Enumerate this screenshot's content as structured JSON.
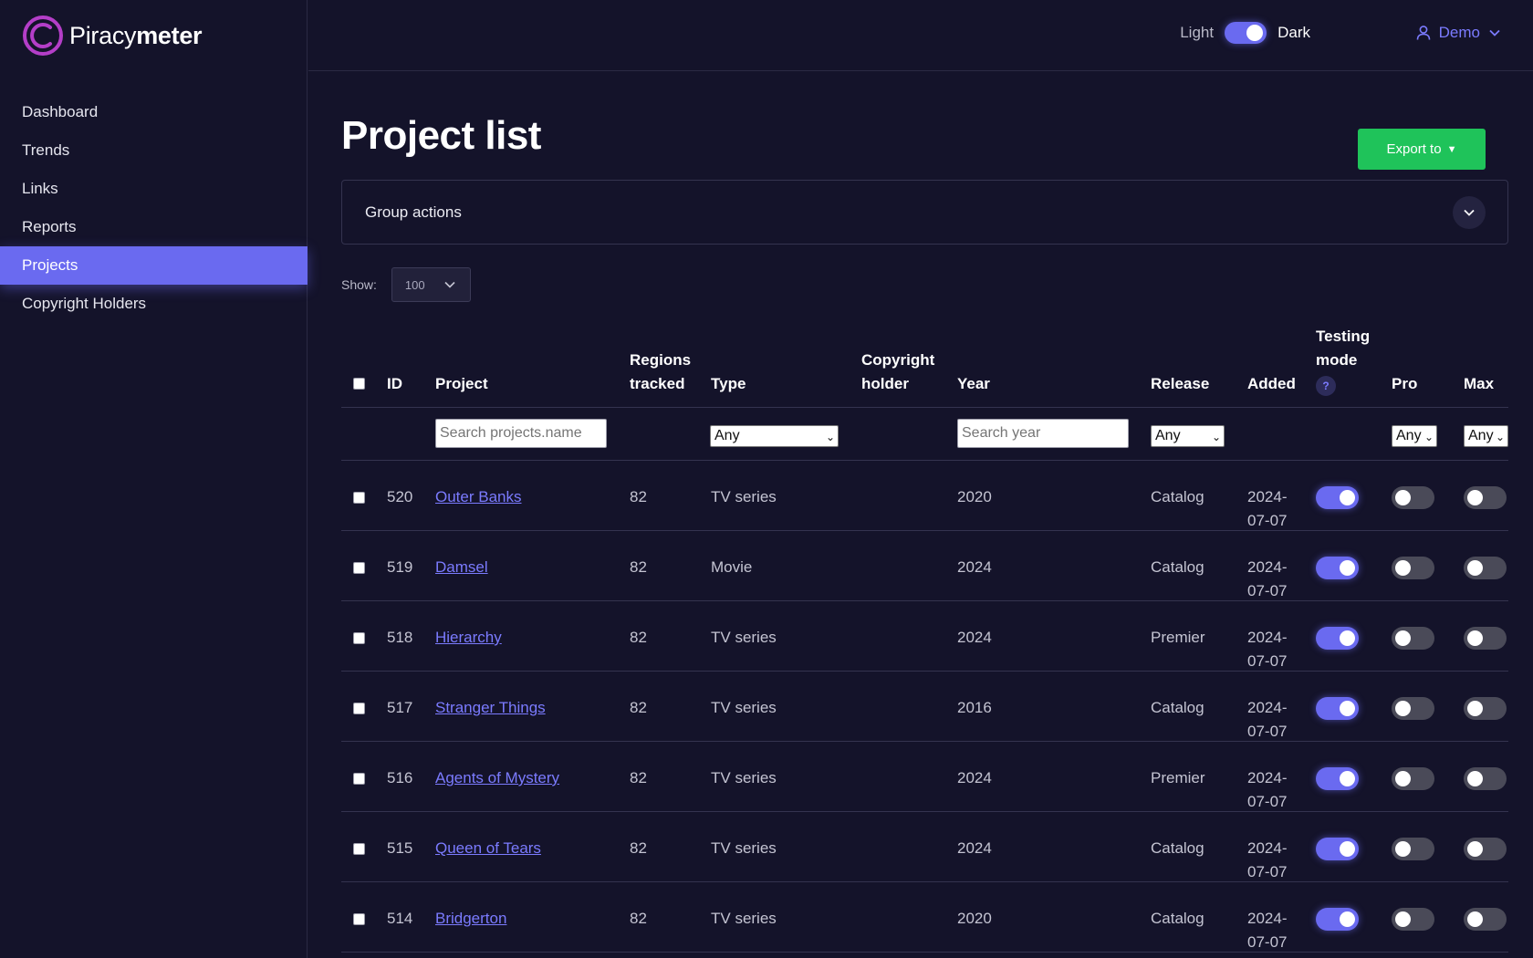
{
  "brand": {
    "name_light": "Piracy",
    "name_bold": "meter"
  },
  "nav": [
    {
      "label": "Dashboard",
      "active": false
    },
    {
      "label": "Trends",
      "active": false
    },
    {
      "label": "Links",
      "active": false
    },
    {
      "label": "Reports",
      "active": false
    },
    {
      "label": "Projects",
      "active": true
    },
    {
      "label": "Copyright Holders",
      "active": false
    }
  ],
  "topbar": {
    "light_label": "Light",
    "dark_label": "Dark",
    "user_name": "Demo"
  },
  "page": {
    "title": "Project list",
    "export_label": "Export to",
    "group_actions_label": "Group actions"
  },
  "show": {
    "label": "Show:",
    "value": "100"
  },
  "table": {
    "headers": {
      "id": "ID",
      "project": "Project",
      "regions_1": "Regions",
      "regions_2": "tracked",
      "type": "Type",
      "holder_1": "Copyright",
      "holder_2": "holder",
      "year": "Year",
      "release": "Release",
      "added": "Added",
      "testing_1": "Testing",
      "testing_2": "mode",
      "testing_help": "?",
      "pro": "Pro",
      "max": "Max"
    },
    "filters": {
      "project_placeholder": "Search projects.name",
      "type_value": "Any",
      "year_placeholder": "Search year",
      "release_value": "Any",
      "pro_value": "Any",
      "max_value": "Any"
    },
    "rows": [
      {
        "id": "520",
        "project": "Outer Banks",
        "regions": "82",
        "type": "TV series",
        "year": "2020",
        "release": "Catalog",
        "added_1": "2024-",
        "added_2": "07-07"
      },
      {
        "id": "519",
        "project": "Damsel",
        "regions": "82",
        "type": "Movie",
        "year": "2024",
        "release": "Catalog",
        "added_1": "2024-",
        "added_2": "07-07"
      },
      {
        "id": "518",
        "project": "Hierarchy",
        "regions": "82",
        "type": "TV series",
        "year": "2024",
        "release": "Premier",
        "added_1": "2024-",
        "added_2": "07-07"
      },
      {
        "id": "517",
        "project": "Stranger Things",
        "regions": "82",
        "type": "TV series",
        "year": "2016",
        "release": "Catalog",
        "added_1": "2024-",
        "added_2": "07-07"
      },
      {
        "id": "516",
        "project": "Agents of Mystery",
        "regions": "82",
        "type": "TV series",
        "year": "2024",
        "release": "Premier",
        "added_1": "2024-",
        "added_2": "07-07"
      },
      {
        "id": "515",
        "project": "Queen of Tears",
        "regions": "82",
        "type": "TV series",
        "year": "2024",
        "release": "Catalog",
        "added_1": "2024-",
        "added_2": "07-07"
      },
      {
        "id": "514",
        "project": "Bridgerton",
        "regions": "82",
        "type": "TV series",
        "year": "2020",
        "release": "Catalog",
        "added_1": "2024-",
        "added_2": "07-07"
      }
    ]
  },
  "colors": {
    "accent": "#6a6af0",
    "link": "#7b7bff",
    "export": "#1fc35a",
    "background": "#14132a"
  },
  "icons": {
    "logo": "piracymeter-logo-icon",
    "user": "user-icon",
    "chevron": "chevron-down-icon"
  }
}
